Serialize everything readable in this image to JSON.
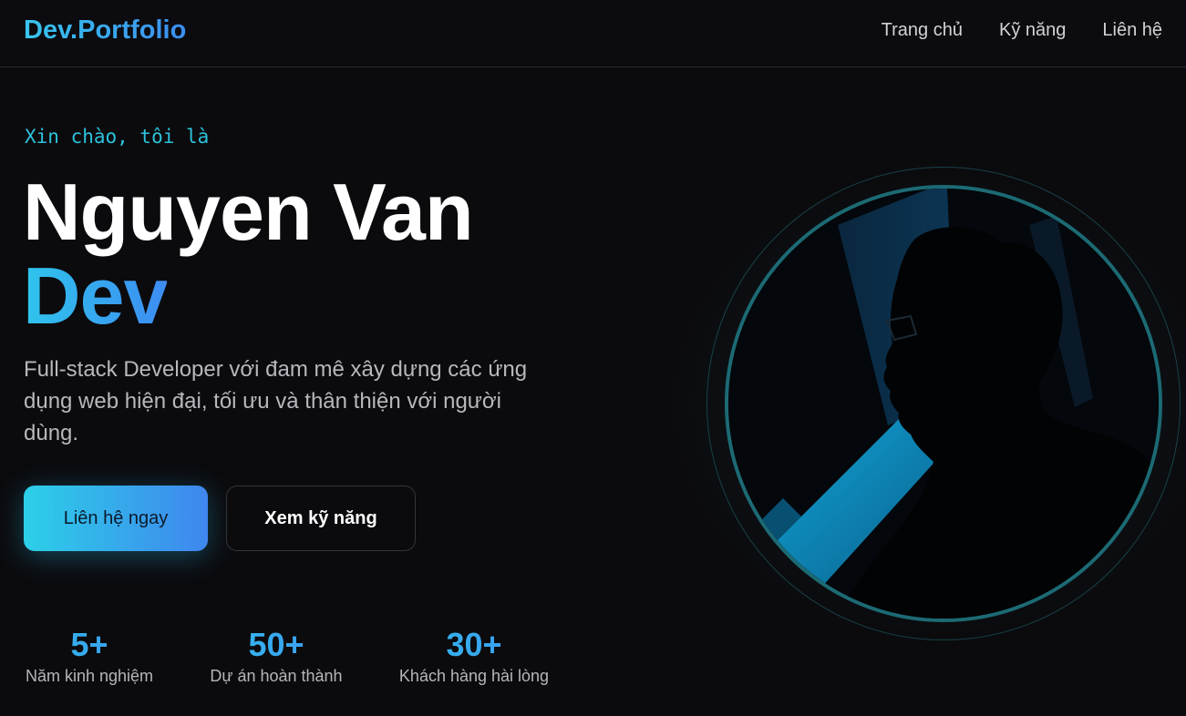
{
  "nav": {
    "logo": "Dev.Portfolio",
    "links": [
      "Trang chủ",
      "Kỹ năng",
      "Liên hệ"
    ]
  },
  "hero": {
    "greeting": "Xin chào, tôi là",
    "name_line1": "Nguyen Van",
    "name_line2": "Dev",
    "description": "Full-stack Developer với đam mê xây dựng các ứng dụng web hiện đại, tối ưu và thân thiện với người dùng.",
    "primary_button": "Liên hệ ngay",
    "secondary_button": "Xem kỹ năng"
  },
  "stats": [
    {
      "value": "5+",
      "label": "Năm kinh nghiệm"
    },
    {
      "value": "50+",
      "label": "Dự án hoàn thành"
    },
    {
      "value": "30+",
      "label": "Khách hàng hài lòng"
    }
  ],
  "colors": {
    "background": "#0b0b0e",
    "accent_cyan": "#2cc3dc",
    "accent_blue": "#3d8df2",
    "ring": "#1c6a74"
  },
  "icons": {
    "avatar": "developer-silhouette-photo"
  }
}
